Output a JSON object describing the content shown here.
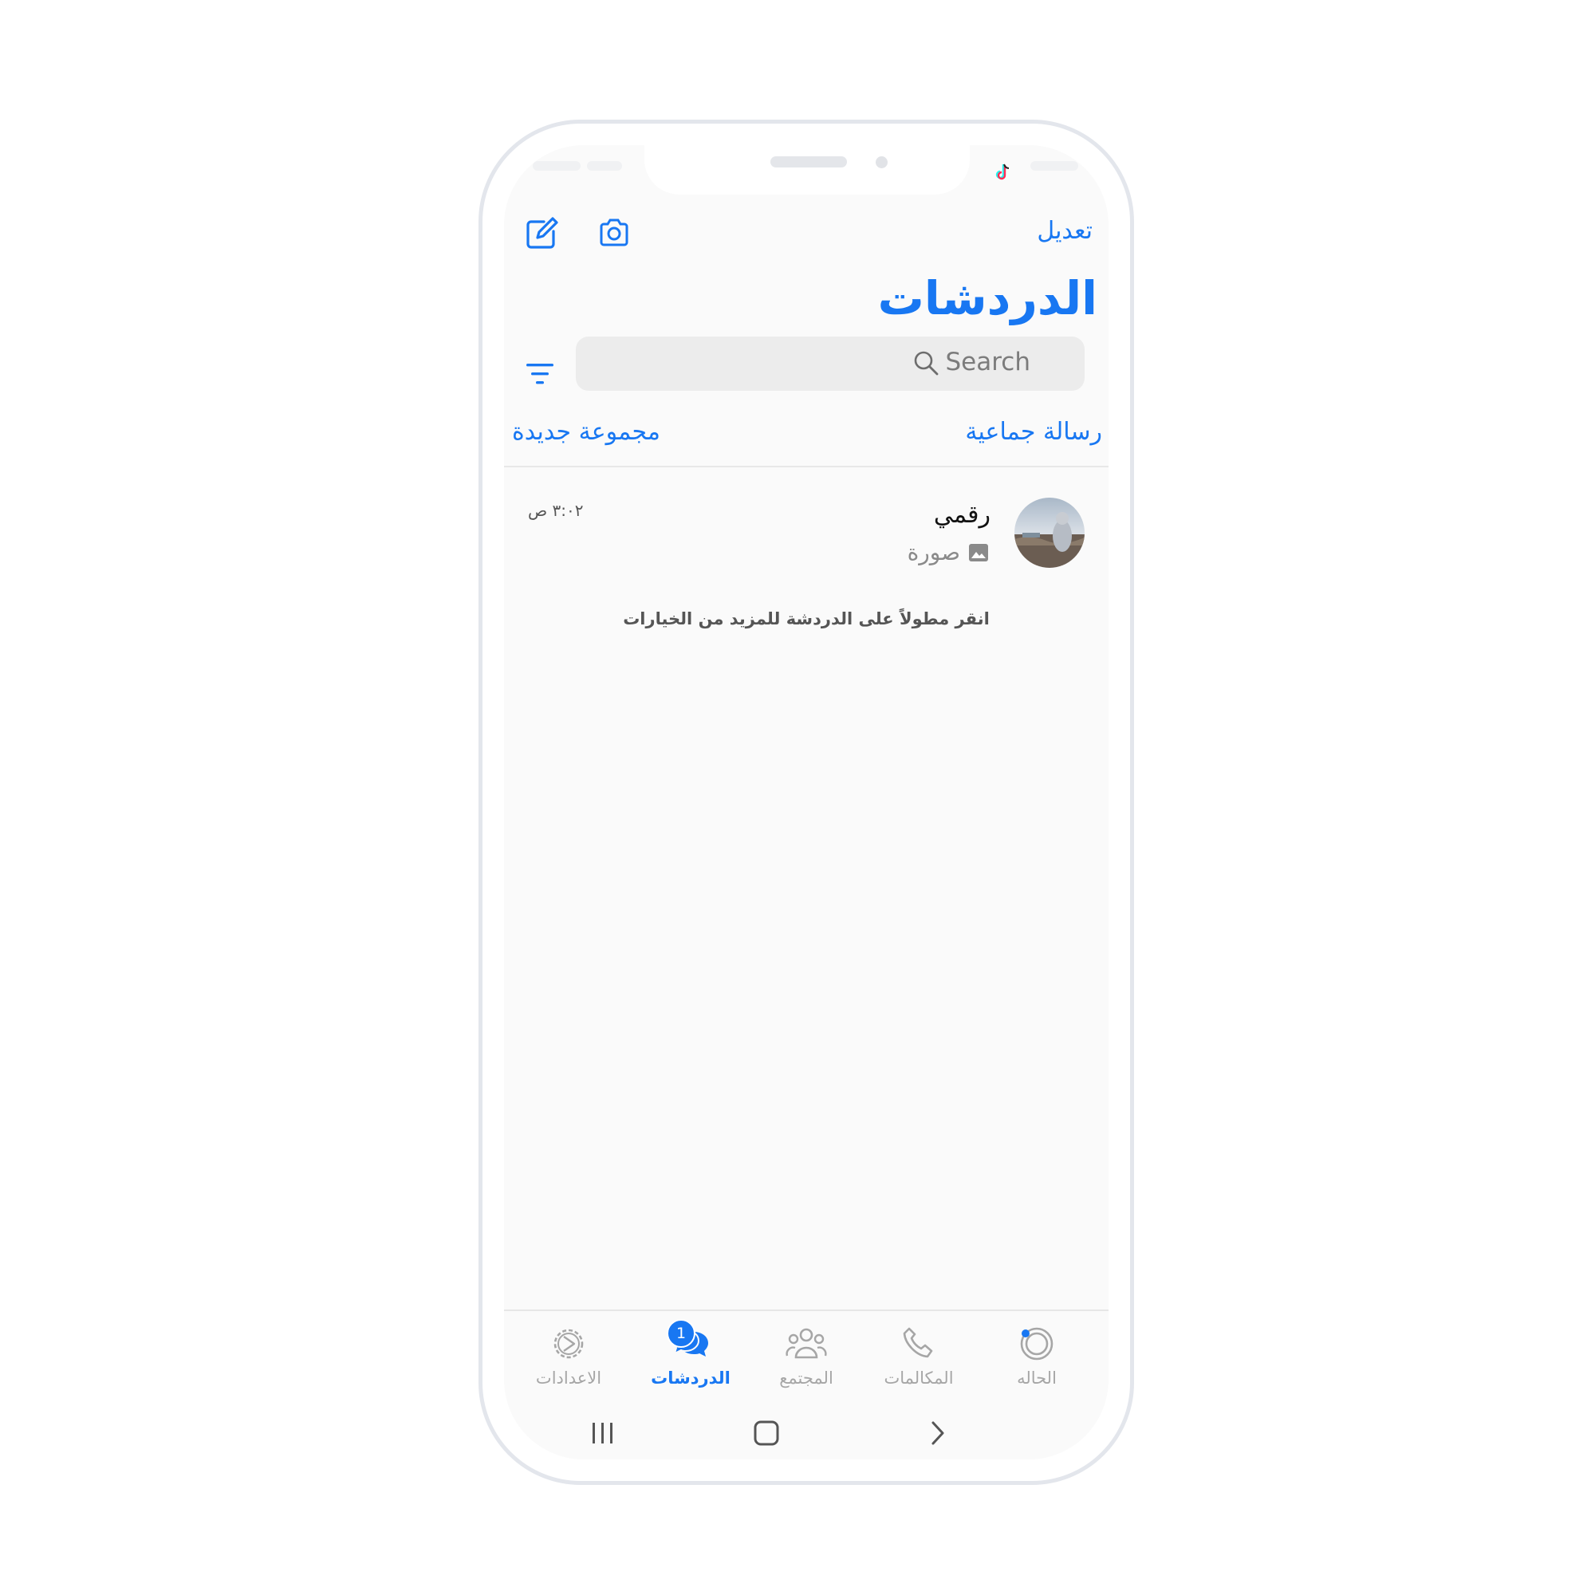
{
  "header": {
    "edit_label": "تعديل",
    "title": "الدردشات"
  },
  "search": {
    "placeholder": "Search"
  },
  "actions": {
    "broadcast_label": "رسالة جماعية",
    "new_group_label": "مجموعة جديدة"
  },
  "chats": [
    {
      "name": "رقمي",
      "time": "٣:٠٢ ص",
      "preview": "صورة",
      "preview_icon": "photo-icon"
    }
  ],
  "hint": "انقر مطولاً على الدردشة للمزيد من الخيارات",
  "tabs": [
    {
      "label": "الحاله",
      "icon": "status-icon",
      "active": false
    },
    {
      "label": "المكالمات",
      "icon": "phone-icon",
      "active": false
    },
    {
      "label": "المجتمع",
      "icon": "community-icon",
      "active": false
    },
    {
      "label": "الدردشات",
      "icon": "chats-icon",
      "active": true,
      "badge": "1"
    },
    {
      "label": "الاعدادات",
      "icon": "settings-icon",
      "active": false
    }
  ],
  "colors": {
    "accent": "#1877f2",
    "inactive": "#a6a6a6",
    "background": "#fafafa"
  }
}
